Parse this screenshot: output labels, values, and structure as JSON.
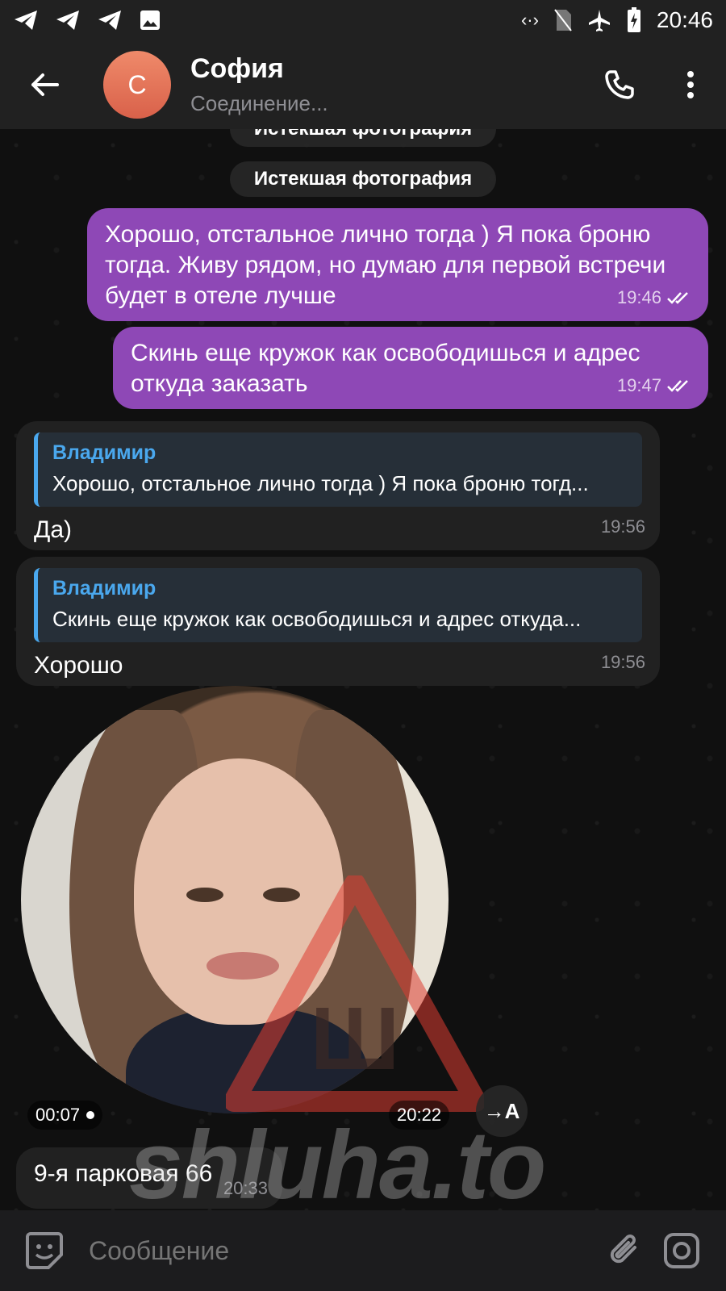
{
  "status_bar": {
    "time": "20:46"
  },
  "header": {
    "avatar_letter": "С",
    "contact_name": "София",
    "contact_status": "Соединение..."
  },
  "service": {
    "expired_photo_1": "Истекшая фотография",
    "expired_photo_2": "Истекшая фотография"
  },
  "messages": {
    "m1": {
      "text": "Хорошо, отстальное лично тогда ) Я пока броню тогда. Живу рядом, но думаю для первой встречи будет в отеле лучше",
      "time": "19:46"
    },
    "m2": {
      "text": "Скинь еще кружок как освободишься и адрес откуда заказать",
      "time": "19:47"
    },
    "m3": {
      "reply_name": "Владимир",
      "reply_text": "Хорошо, отстальное лично тогда ) Я пока броню тогд...",
      "text": "Да)",
      "time": "19:56"
    },
    "m4": {
      "reply_name": "Владимир",
      "reply_text": "Скинь еще кружок как освободишься и адрес откуда...",
      "text": "Хорошо",
      "time": "19:56"
    },
    "video": {
      "duration": "00:07",
      "time": "20:22",
      "translate_label": "A"
    },
    "m5": {
      "text": "9-я парковая 66",
      "time": "20:33"
    }
  },
  "watermark": {
    "text": "shluha.to",
    "logo_letter": "Ш"
  },
  "composer": {
    "placeholder": "Сообщение"
  },
  "colors": {
    "outgoing": "#8e48b6",
    "incoming": "#212121",
    "accent": "#4aa8ee"
  }
}
